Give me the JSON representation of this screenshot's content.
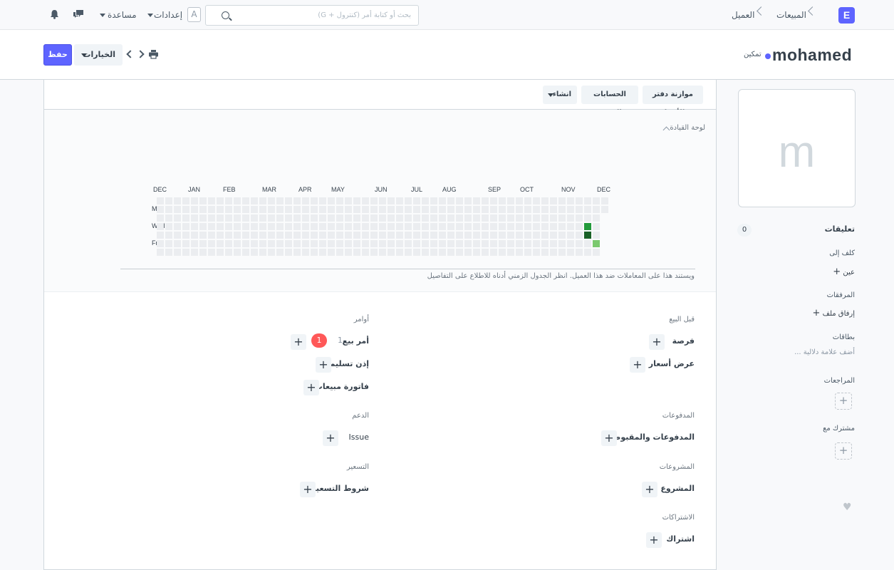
{
  "app": {
    "logo_letter": "E"
  },
  "breadcrumbs": [
    "المبيعات",
    "العميل"
  ],
  "search": {
    "placeholder": "بحث أو كتابة أمر (كنترول + G)"
  },
  "navbar": {
    "avatar_letter": "A",
    "settings_label": "إعدادات",
    "help_label": "مساعدة"
  },
  "doc": {
    "title": "mohamed",
    "indicator": "تمكين",
    "save_label": "حفظ",
    "options_label": "الخيارات"
  },
  "sidebar": {
    "avatar_letter": "m",
    "comments_label": "تعليقات",
    "comments_count": "0",
    "assign_label": "كلف إلى",
    "assign_link": "عين",
    "attachments_label": "المرفقات",
    "attach_link": "إرفاق ملف",
    "tags_label": "بطاقات",
    "add_tag": "أضف علامة دلالية ...",
    "reviews_label": "المراجعات",
    "shared_label": "مشترك مع"
  },
  "toolbar": {
    "ledger_btn": "موازنة دفتر الأستاذ",
    "accounts_btn": "الحسابات المدينة",
    "create_btn": "انشاء"
  },
  "dashboard": {
    "title": "لوحة القيادة",
    "months": [
      "DEC",
      "JAN",
      "FEB",
      "MAR",
      "APR",
      "MAY",
      "JUN",
      "JUL",
      "AUG",
      "SEP",
      "OCT",
      "NOV",
      "DEC"
    ],
    "days": [
      "Mon",
      "Wed",
      "Fri"
    ],
    "note": "ويستند هذا على المعاملات ضد هذا العميل. انظر الجدول الزمني أدناه للاطلاع على التفاصيل",
    "active_cells": [
      {
        "week": 50,
        "day": 3,
        "level": 3
      },
      {
        "week": 50,
        "day": 4,
        "level": 4
      },
      {
        "week": 51,
        "day": 5,
        "level": 2
      }
    ],
    "colors": {
      "empty": "#ebedf0",
      "l2": "#7bc96f",
      "l3": "#239a3b",
      "l4": "#196127"
    }
  },
  "connections": {
    "pre_sales": {
      "label": "قبل البيع",
      "items": [
        "فرصة",
        "عرض أسعار"
      ]
    },
    "orders": {
      "label": "أوامر",
      "items": [
        "أمر بيع",
        "إذن تسليم",
        "فاتورة مبيعات"
      ],
      "sales_order_count": "1",
      "badge": "1"
    },
    "payments": {
      "label": "المدفوعات",
      "items": [
        "المدفوعات والمقبوضات"
      ]
    },
    "support": {
      "label": "الدعم",
      "items": [
        "Issue"
      ]
    },
    "projects": {
      "label": "المشروعات",
      "items": [
        "المشروع"
      ]
    },
    "pricing": {
      "label": "التسعير",
      "items": [
        "شروط التسعير"
      ]
    },
    "subscriptions": {
      "label": "الاشتراكات",
      "items": [
        "اشتراك"
      ]
    }
  }
}
